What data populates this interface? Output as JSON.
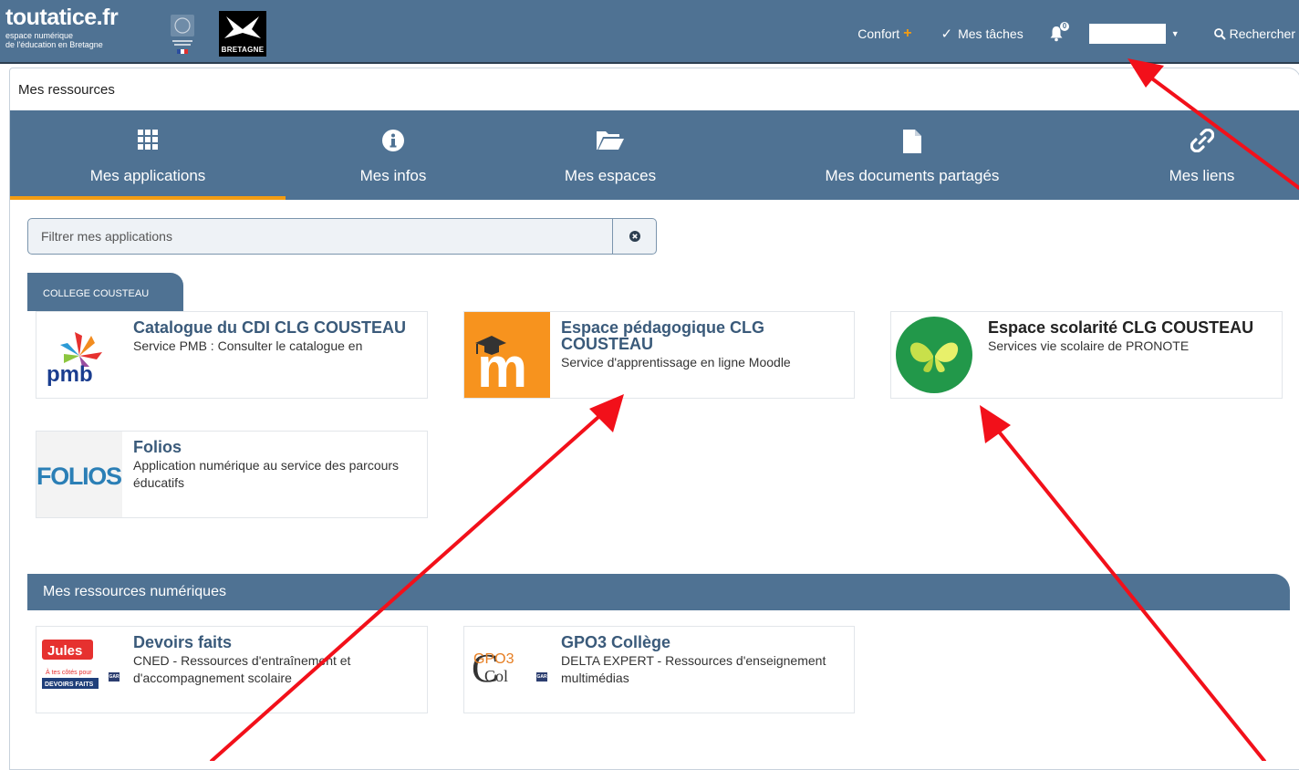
{
  "brand": {
    "name": "toutatice.fr",
    "subtitle_line1": "espace numérique",
    "subtitle_line2": "de l'éducation en Bretagne",
    "region_label": "BRETAGNE"
  },
  "topnav": {
    "confort_label": "Confort",
    "confort_plus": "+",
    "tasks_label": "Mes tâches",
    "notifications_count": "0",
    "search_label": "Rechercher"
  },
  "panel": {
    "title": "Mes ressources"
  },
  "tabs": [
    {
      "label": "Mes applications",
      "icon": "grid-icon",
      "active": true
    },
    {
      "label": "Mes infos",
      "icon": "info-icon",
      "active": false
    },
    {
      "label": "Mes espaces",
      "icon": "folder-open-icon",
      "active": false
    },
    {
      "label": "Mes documents partagés",
      "icon": "file-icon",
      "active": false
    },
    {
      "label": "Mes liens",
      "icon": "link-icon",
      "active": false
    }
  ],
  "filter": {
    "placeholder": "Filtrer mes applications"
  },
  "group": {
    "label": "COLLEGE COUSTEAU"
  },
  "apps": [
    {
      "title": "Catalogue du CDI CLG COUSTEAU",
      "description": "Service PMB : Consulter le catalogue en",
      "logo_text": "pmb"
    },
    {
      "title": "Espace pédagogique CLG COUSTEAU",
      "description": "Service d'apprentissage en ligne Moodle",
      "logo_text": "m"
    },
    {
      "title": "Espace scolarité CLG COUSTEAU",
      "description": "Services vie scolaire de PRONOTE"
    },
    {
      "title": "Folios",
      "description": "Application numérique au service des parcours éducatifs",
      "logo_text": "FOLIOS"
    }
  ],
  "resources_section": {
    "title": "Mes ressources numériques"
  },
  "resources": [
    {
      "title": "Devoirs faits",
      "description": "CNED - Ressources d'entraînement et d'accompagnement scolaire",
      "logo_text_top": "Jules",
      "logo_text_bottom": "DEVOIRS FAITS",
      "logo_caption": "À tes côtés pour",
      "gar": "GAR"
    },
    {
      "title": "GPO3 Collège",
      "description": "DELTA EXPERT - Ressources d'enseignement multimédias",
      "logo_text_top": "GPO3",
      "logo_text_bottom": "Col",
      "gar": "GAR"
    }
  ],
  "colors": {
    "primary": "#4f7293",
    "accent": "#f39c12",
    "arrow": "#f2101a"
  }
}
